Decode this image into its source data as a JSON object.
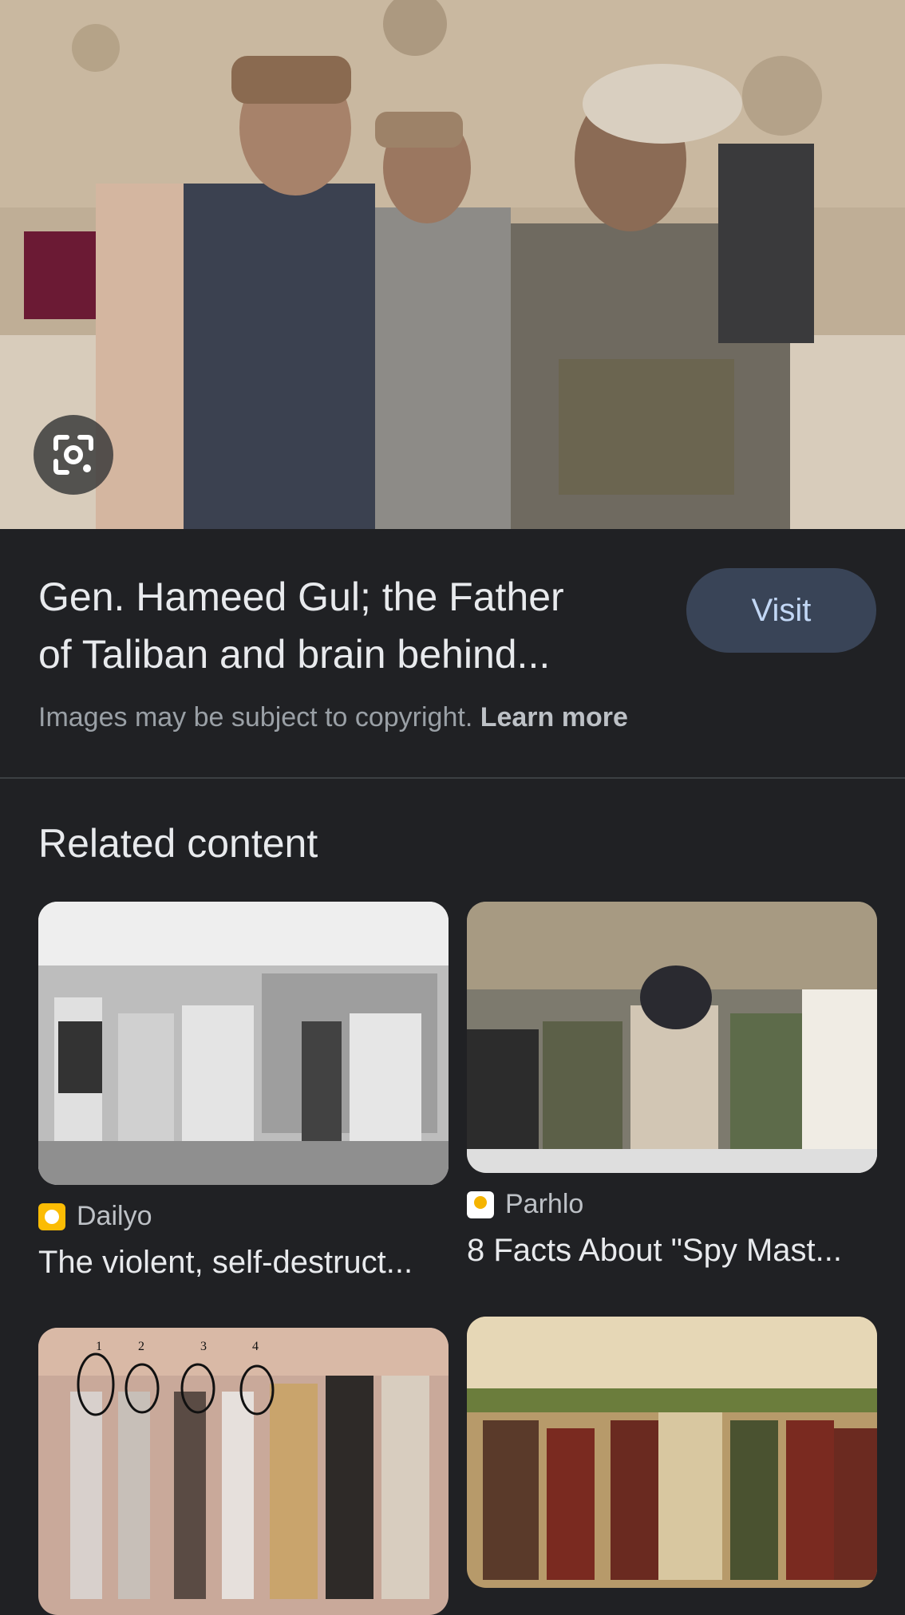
{
  "result": {
    "title_line1": "Gen. Hameed Gul; the Father",
    "title_line2": "of Taliban and brain behind...",
    "visit_label": "Visit",
    "copyright_text": "Images may be subject to copyright.",
    "learn_more": "Learn more"
  },
  "related": {
    "heading": "Related content",
    "cards": [
      {
        "source": "Dailyo",
        "title": "The violent, self-destruct...",
        "favicon_color": "#fbbc04"
      },
      {
        "source": "Parhlo",
        "title": "8 Facts About \"Spy Mast...",
        "favicon_color": "#ffffff"
      },
      {
        "source": "",
        "title": ""
      },
      {
        "source": "",
        "title": ""
      }
    ]
  },
  "photo_labels": {
    "related_3_numbers": [
      "1",
      "2",
      "3",
      "4"
    ]
  },
  "colors": {
    "background": "#202124",
    "visit_button": "#394457",
    "visit_text": "#c2d7f5"
  }
}
